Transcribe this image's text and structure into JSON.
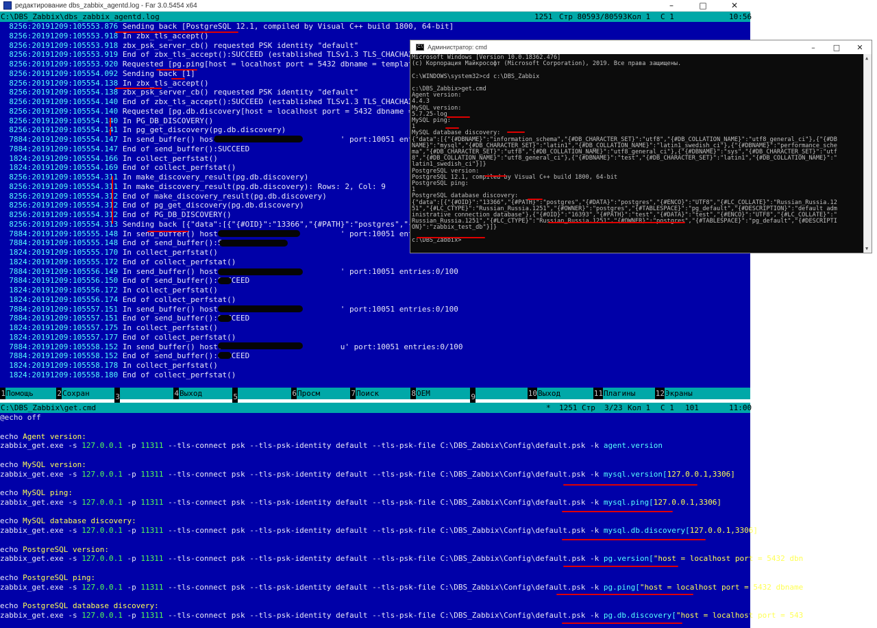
{
  "far": {
    "title": "редактирование dbs_zabbix_agentd.log - Far 3.0.5454 x64",
    "status": {
      "path": "C:\\DBS_Zabbix\\dbs_zabbix_agentd.log",
      "code": "1251",
      "line": "Стр 80593/80593",
      "col": "Кол 1",
      "char": "С 1",
      "time": "10:56"
    },
    "log_lines": [
      {
        "ts": "8256:20191209:105553.876",
        "msg": "Sending back [PostgreSQL 12.1, compiled by Visual C++ build 1800, 64-bit]"
      },
      {
        "ts": "8256:20191209:105553.918",
        "msg": "In zbx_tls_accept()"
      },
      {
        "ts": "8256:20191209:105553.918",
        "msg": "zbx_psk_server_cb() requested PSK identity \"default\""
      },
      {
        "ts": "8256:20191209:105553.919",
        "msg": "End of zbx_tls_accept():SUCCEED (established TLSv1.3 TLS_CHACHA20_POLY"
      },
      {
        "ts": "8256:20191209:105553.920",
        "msg": "Requested [pg.ping[host = localhost port = 5432 dbname = template1 use"
      },
      {
        "ts": "8256:20191209:105554.092",
        "msg": "Sending back [1]"
      },
      {
        "ts": "8256:20191209:105554.138",
        "msg": "In zbx_tls_accept()"
      },
      {
        "ts": "8256:20191209:105554.138",
        "msg": "zbx_psk_server_cb() requested PSK identity \"default\""
      },
      {
        "ts": "8256:20191209:105554.140",
        "msg": "End of zbx_tls_accept():SUCCEED (established TLSv1.3 TLS_CHACHA20_POLY"
      },
      {
        "ts": "8256:20191209:105554.140",
        "msg": "Requested [pg.db.discovery[host = localhost port = 5432 dbname = templ"
      },
      {
        "ts": "8256:20191209:105554.140",
        "msg": "In PG_DB_DISCOVERY()"
      },
      {
        "ts": "8256:20191209:105554.141",
        "msg": "In pg_get_discovery(pg.db.discovery)"
      },
      {
        "ts": "7884:20191209:105554.147",
        "msg": "In send_buffer() host:'                         ' port:10051 entries:0/100"
      },
      {
        "ts": "7884:20191209:105554.147",
        "msg": "End of send_buffer():SUCCEED"
      },
      {
        "ts": "1824:20191209:105554.166",
        "msg": "In collect_perfstat()"
      },
      {
        "ts": "1824:20191209:105554.169",
        "msg": "End of collect_perfstat()"
      },
      {
        "ts": "8256:20191209:105554.311",
        "msg": "In make_discovery_result(pg.db.discovery)"
      },
      {
        "ts": "8256:20191209:105554.311",
        "msg": "In make_discovery_result(pg.db.discovery): Rows: 2, Col: 9"
      },
      {
        "ts": "8256:20191209:105554.312",
        "msg": "End of make_discovery_result(pg.db.discovery)"
      },
      {
        "ts": "8256:20191209:105554.312",
        "msg": "End of pg_get_discovery(pg.db.discovery)"
      },
      {
        "ts": "8256:20191209:105554.312",
        "msg": "End of PG_DB_DISCOVERY()"
      },
      {
        "ts": "8256:20191209:105554.313",
        "msg": "Sending back [{\"data\":[{\"{#OID}\":\"13366\",\"{#PATH}\":\"postgres\",\"{#DATA}"
      },
      {
        "ts": "7884:20191209:105555.148",
        "msg": "In send_buffer() host:'                         ' port:10051 entries:0/100"
      },
      {
        "ts": "7884:20191209:105555.148",
        "msg": "End of send_buffer():SUCCEED"
      },
      {
        "ts": "1824:20191209:105555.170",
        "msg": "In collect_perfstat()"
      },
      {
        "ts": "1824:20191209:105555.172",
        "msg": "End of collect_perfstat()"
      },
      {
        "ts": "7884:20191209:105556.149",
        "msg": "In send_buffer() host:'                         ' port:10051 entries:0/100"
      },
      {
        "ts": "7884:20191209:105556.150",
        "msg": "End of send_buffer():SUCCEED"
      },
      {
        "ts": "1824:20191209:105556.172",
        "msg": "In collect_perfstat()"
      },
      {
        "ts": "1824:20191209:105556.174",
        "msg": "End of collect_perfstat()"
      },
      {
        "ts": "7884:20191209:105557.151",
        "msg": "In send_buffer() host:'                         ' port:10051 entries:0/100"
      },
      {
        "ts": "7884:20191209:105557.151",
        "msg": "End of send_buffer():SUCCEED"
      },
      {
        "ts": "1824:20191209:105557.175",
        "msg": "In collect_perfstat()"
      },
      {
        "ts": "1824:20191209:105557.177",
        "msg": "End of collect_perfstat()"
      },
      {
        "ts": "7884:20191209:105558.152",
        "msg": "In send_buffer() host:'                         u' port:10051 entries:0/100"
      },
      {
        "ts": "7884:20191209:105558.152",
        "msg": "End of send_buffer():SUCCEED"
      },
      {
        "ts": "1824:20191209:105558.178",
        "msg": "In collect_perfstat()"
      },
      {
        "ts": "1824:20191209:105558.180",
        "msg": "End of collect_perfstat()"
      }
    ],
    "keybar": [
      {
        "num": "1",
        "label": "Помощь"
      },
      {
        "num": "2",
        "label": "Сохран"
      },
      {
        "num": "3",
        "label": ""
      },
      {
        "num": "4",
        "label": "Выход"
      },
      {
        "num": "5",
        "label": ""
      },
      {
        "num": "6",
        "label": "Просм"
      },
      {
        "num": "7",
        "label": "Поиск"
      },
      {
        "num": "8",
        "label": "OEM"
      },
      {
        "num": "9",
        "label": ""
      },
      {
        "num": "10",
        "label": "Выход"
      },
      {
        "num": "11",
        "label": "Плагины"
      },
      {
        "num": "12",
        "label": "Экраны"
      }
    ]
  },
  "cmd": {
    "title": "Администратор: cmd",
    "lines": [
      "Microsoft Windows [Version 10.0.18362.476]",
      "(c) Корпорация Майкрософт (Microsoft Corporation), 2019. Все права защищены.",
      "",
      "C:\\WINDOWS\\system32>cd c:\\DBS_Zabbix",
      "",
      "c:\\DBS_Zabbix>get.cmd",
      "Agent version:",
      "4.4.3",
      "MySQL version:",
      "5.7.25-log",
      "MySQL ping:",
      "1",
      "MySQL database discovery:",
      "{\"data\":[{\"{#DBNAME}\":\"information_schema\",\"{#DB_CHARACTER_SET}\":\"utf8\",\"{#DB_COLLATION_NAME}\":\"utf8_general_ci\"},{\"{#DB",
      "NAME}\":\"mysql\",\"{#DB_CHARACTER_SET}\":\"latin1\",\"{#DB_COLLATION_NAME}\":\"latin1_swedish_ci\"},{\"{#DBNAME}\":\"performance_sche",
      "ma\",\"{#DB_CHARACTER_SET}\":\"utf8\",\"{#DB_COLLATION_NAME}\":\"utf8_general_ci\"},{\"{#DBNAME}\":\"sys\",\"{#DB_CHARACTER_SET}\":\"utf",
      "8\",\"{#DB_COLLATION_NAME}\":\"utf8_general_ci\"},{\"{#DBNAME}\":\"test\",\"{#DB_CHARACTER_SET}\":\"latin1\",\"{#DB_COLLATION_NAME}\":\"",
      "latin1_swedish_ci\"}]}",
      "PostgreSQL version:",
      "PostgreSQL 12.1, compiled by Visual C++ build 1800, 64-bit",
      "PostgreSQL ping:",
      "1",
      "PostgreSQL database discovery:",
      "{\"data\":[{\"{#OID}\":\"13366\",\"{#PATH}\":\"postgres\",\"{#DATA}\":\"postgres\",\"{#ENCO}\":\"UTF8\",\"{#LC_COLLATE}\":\"Russian_Russia.12",
      "51\",\"{#LC_CTYPE}\":\"Russian_Russia.1251\",\"{#OWNER}\":\"postgres\",\"{#TABLESPACE}\":\"pg_default\",\"{#DESCRIPTION}\":\"default adm",
      "inistrative connection database\"},{\"{#OID}\":\"16393\",\"{#PATH}\":\"test\",\"{#DATA}\":\"test\",\"{#ENCO}\":\"UTF8\",\"{#LC_COLLATE}\":\"",
      "Russian_Russia.1251\",\"{#LC_CTYPE}\":\"Russian_Russia.1251\",\"{#OWNER}\":\"postgres\",\"{#TABLESPACE}\":\"pg_default\",\"{#DESCRIPTI",
      "ON}\":\"zabbix_test_db\"}]}",
      "",
      "c:\\DBS_Zabbix>"
    ]
  },
  "editor": {
    "status": {
      "path": "C:\\DBS_Zabbix\\get.cmd",
      "mod": "*",
      "code": "1251",
      "line": "Стр  3/23",
      "col": "Кол 1",
      "char": "С 1",
      "byte": "101",
      "time": "11:00"
    },
    "first_line": "@echo off",
    "blocks": [
      {
        "echo": "Agent version:",
        "args": [
          "agent.version",
          ""
        ]
      },
      {
        "echo": "MySQL version:",
        "args": [
          "mysql.version[",
          "127.0.0.1,3306]"
        ]
      },
      {
        "echo": "MySQL ping:",
        "args": [
          "mysql.ping[",
          "127.0.0.1,3306]"
        ]
      },
      {
        "echo": "MySQL database discovery:",
        "args": [
          "mysql.db.discovery[",
          "127.0.0.1,3306]"
        ]
      },
      {
        "echo": "PostgreSQL version:",
        "args": [
          "pg.version[",
          "\"host = localhost port = 5432 dbn"
        ]
      },
      {
        "echo": "PostgreSQL ping:",
        "args": [
          "pg.ping[",
          "\"host = localhost port = 5432 dbname"
        ]
      },
      {
        "echo": "PostgreSQL database discovery:",
        "args": [
          "pg.db.discovery[",
          "\"host = localhost port = 543"
        ]
      }
    ],
    "cmd_prefix": {
      "exe": "zabbix_get.exe",
      "s_flag": "-s",
      "host": "127.0.0.1",
      "p_flag": "-p",
      "port": "11311",
      "tls_connect": "--tls-connect psk --tls-psk-identity default --tls-psk-file",
      "psk_path": "C:\\DBS_Zabbix\\Config\\default.psk",
      "k_flag": "-k"
    },
    "echo_word": "echo"
  },
  "colors": {
    "far_blue": "#0000a8",
    "far_cyan": "#00a8a8",
    "annotation_red": "#e00000"
  }
}
